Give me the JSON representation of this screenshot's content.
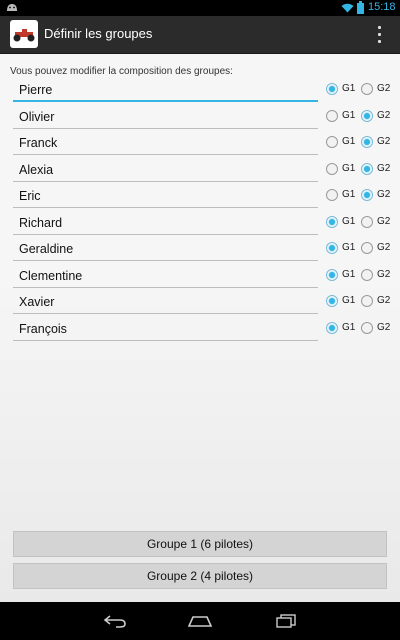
{
  "status_bar": {
    "time": "15:18"
  },
  "action_bar": {
    "title": "Définir les groupes"
  },
  "instructions": "Vous pouvez modifier la composition des groupes:",
  "radio_labels": {
    "g1": "G1",
    "g2": "G2"
  },
  "pilots": [
    {
      "name": "Pierre",
      "group": "G1"
    },
    {
      "name": "Olivier",
      "group": "G2"
    },
    {
      "name": "Franck",
      "group": "G2"
    },
    {
      "name": "Alexia",
      "group": "G2"
    },
    {
      "name": "Eric",
      "group": "G2"
    },
    {
      "name": "Richard",
      "group": "G1"
    },
    {
      "name": "Geraldine",
      "group": "G1"
    },
    {
      "name": "Clementine",
      "group": "G1"
    },
    {
      "name": "Xavier",
      "group": "G1"
    },
    {
      "name": "François",
      "group": "G1"
    }
  ],
  "buttons": {
    "group1": "Groupe 1 (6 pilotes)",
    "group2": "Groupe 2 (4 pilotes)"
  },
  "colors": {
    "accent": "#33b5e5",
    "action_bar": "#2b2b2b"
  },
  "icons": [
    "android-icon",
    "wifi-icon",
    "battery-icon",
    "app-logo",
    "overflow-menu-icon",
    "back-icon",
    "home-icon",
    "recent-apps-icon"
  ]
}
